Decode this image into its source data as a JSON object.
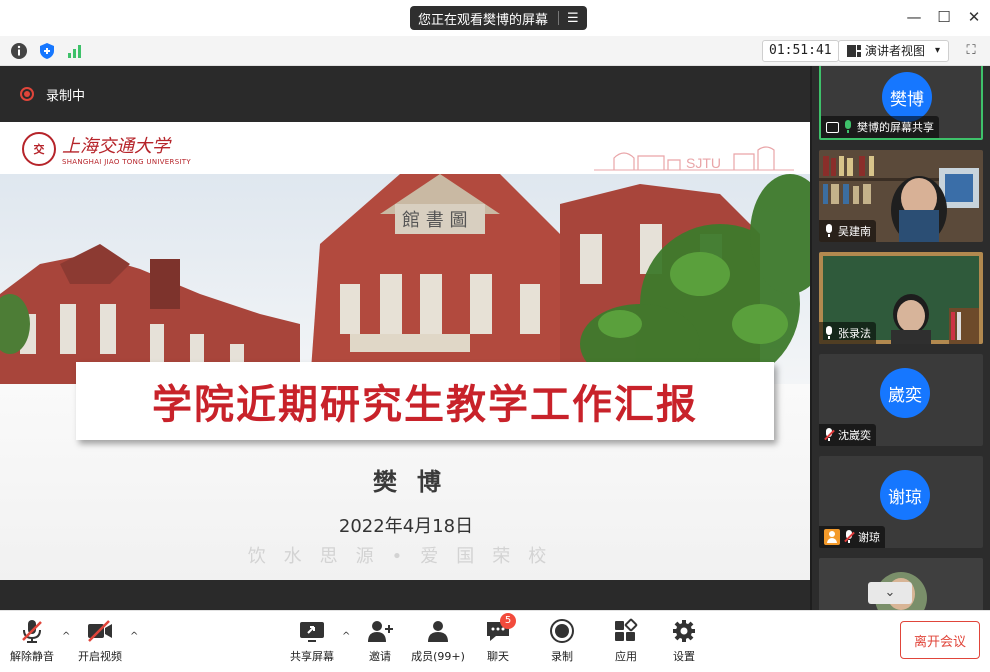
{
  "title_bar": {
    "share_banner": "您正在观看樊博的屏幕",
    "banner_menu_icon": "list-menu-icon",
    "minimize_icon": "minimize-icon",
    "maximize_icon": "maximize-icon",
    "close_icon": "close-icon"
  },
  "info_bar": {
    "info_icon": "info-icon",
    "security_icon": "shield-icon",
    "signal_icon": "signal-bars-icon",
    "timer": "01:51:41",
    "view_mode": "演讲者视图",
    "view_mode_caret": "▾",
    "fullscreen_icon": "fullscreen-icon"
  },
  "recording": {
    "label": "录制中"
  },
  "slide": {
    "logo_cn": "上海交通大学",
    "logo_en": "SHANGHAI JIAO TONG UNIVERSITY",
    "logo_seal": "交",
    "sjtu_mark": "SJTU",
    "title": "学院近期研究生教学工作汇报",
    "presenter": "樊博",
    "date": "2022年4月18日",
    "motto": "饮水思源•爱国荣校"
  },
  "participants": [
    {
      "avatar_text": "樊博",
      "label": "樊博的屏幕共享",
      "type": "avatar",
      "mic": "green",
      "sharing": true
    },
    {
      "label": "吴建南",
      "type": "video-bookshelf",
      "mic": "on"
    },
    {
      "label": "张录法",
      "type": "video-board",
      "mic": "on"
    },
    {
      "avatar_text": "崴奕",
      "label": "沈崴奕",
      "type": "avatar",
      "mic": "muted"
    },
    {
      "avatar_text": "谢琼",
      "label": "谢琼",
      "type": "avatar",
      "mic": "muted",
      "host_icon": true
    },
    {
      "label": "",
      "type": "video-partial"
    }
  ],
  "collapse_icon": "chevron-down-icon",
  "colors": {
    "accent": "#1677ff",
    "danger": "#e0453a",
    "active_green": "#3ec16a",
    "slide_red": "#c8222a"
  },
  "toolbar": {
    "unmute": "解除静音",
    "start_video": "开启视频",
    "share_screen": "共享屏幕",
    "invite": "邀请",
    "members": "成员(99+)",
    "chat": "聊天",
    "chat_badge": "5",
    "record": "录制",
    "apps": "应用",
    "settings": "设置",
    "leave": "离开会议",
    "caret": "^"
  }
}
